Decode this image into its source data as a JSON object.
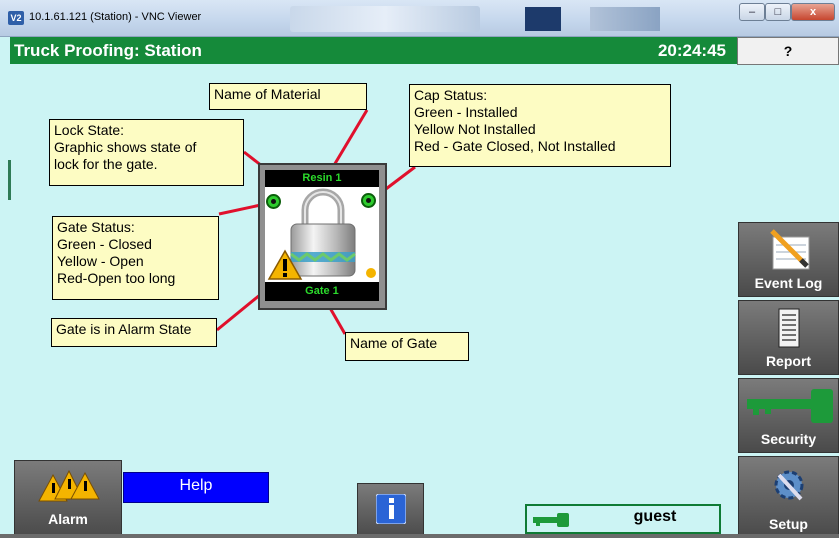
{
  "window": {
    "title": "10.1.61.121 (Station) - VNC Viewer",
    "logo": "V2",
    "min_symbol": "–",
    "max_symbol": "□",
    "close_symbol": "x"
  },
  "header": {
    "title": "Truck Proofing: Station",
    "clock": "20:24:45",
    "help_label": "?"
  },
  "callouts": {
    "name_of_material": "Name of Material",
    "lock_state": [
      "Lock State:",
      "Graphic shows state of",
      "lock for the gate."
    ],
    "cap_status": [
      "Cap Status:",
      "Green - Installed",
      "Yellow Not Installed",
      "Red - Gate Closed, Not Installed"
    ],
    "gate_status": [
      "Gate Status:",
      "Green - Closed",
      "Yellow - Open",
      "Red-Open too long"
    ],
    "alarm_state": "Gate is in Alarm State",
    "name_of_gate": "Name of Gate"
  },
  "gate_tile": {
    "material": "Resin 1",
    "gate": "Gate 1",
    "gate_status_color": "#2ecc2e",
    "cap_status_color": "#2ecc2e",
    "alarm": true
  },
  "side_buttons": {
    "event_log": "Event Log",
    "report": "Report",
    "security": "Security",
    "setup": "Setup"
  },
  "bottom": {
    "alarm_label": "Alarm",
    "help_label": "Help",
    "user": "guest"
  },
  "colors": {
    "background": "#ccf4f4",
    "header": "#158a3a",
    "callout": "#fdfcc3",
    "leader": "#e0102c",
    "help_bar": "#0000ff"
  }
}
